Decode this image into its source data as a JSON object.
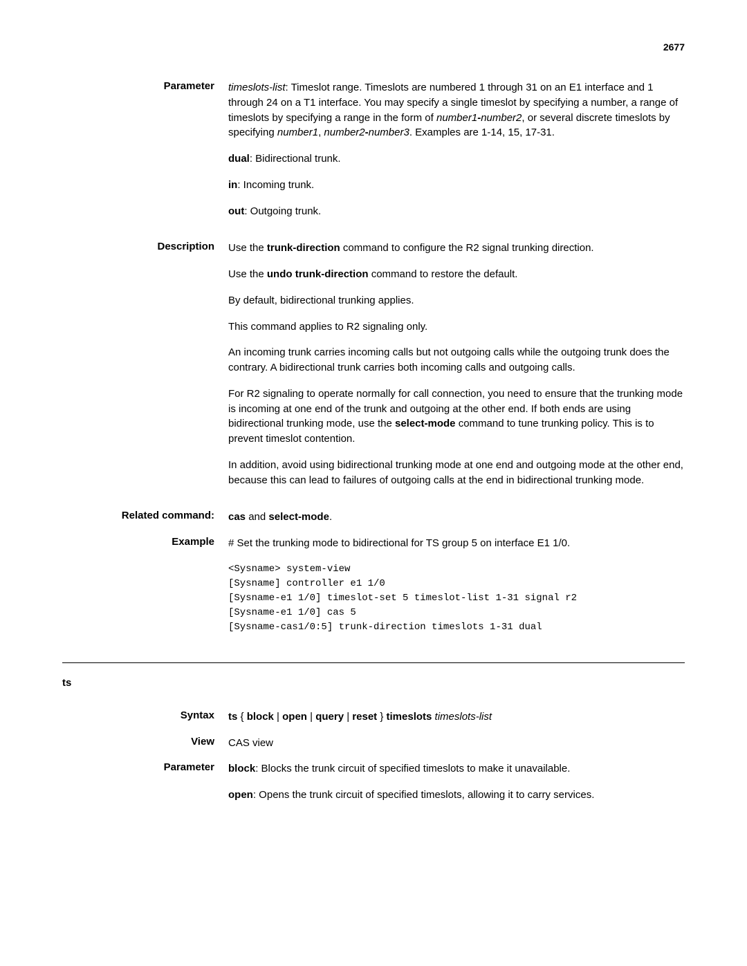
{
  "pageNumber": "2677",
  "sections1": {
    "parameter": {
      "label": "Parameter",
      "p1_a": "timeslots-list",
      "p1_b": ": Timeslot range. Timeslots are numbered 1 through 31 on an E1 interface and 1 through 24 on a T1 interface. You may specify a single timeslot by specifying a number, a range of timeslots by specifying a range in the form of ",
      "p1_c": "number1",
      "p1_d": "-",
      "p1_e": "number2",
      "p1_f": ", or several discrete timeslots by specifying ",
      "p1_g": "number1",
      "p1_h": ", ",
      "p1_i": "number2",
      "p1_j": "-",
      "p1_k": "number3",
      "p1_l": ". Examples are 1-14, 15, 17-31.",
      "p2_a": "dual",
      "p2_b": ": Bidirectional trunk.",
      "p3_a": "in",
      "p3_b": ": Incoming trunk.",
      "p4_a": "out",
      "p4_b": ": Outgoing trunk."
    },
    "description": {
      "label": "Description",
      "p1_a": "Use the ",
      "p1_b": "trunk-direction",
      "p1_c": " command to configure the R2 signal trunking direction.",
      "p2_a": "Use the ",
      "p2_b": "undo trunk-direction",
      "p2_c": " command to restore the default.",
      "p3": "By default, bidirectional trunking applies.",
      "p4": "This command applies to R2 signaling only.",
      "p5": "An incoming trunk carries incoming calls but not outgoing calls while the outgoing trunk does the contrary. A bidirectional trunk carries both incoming calls and outgoing calls.",
      "p6_a": "For R2 signaling to operate normally for call connection, you need to ensure that the trunking mode is incoming at one end of the trunk and outgoing at the other end. If both ends are using bidirectional trunking mode, use the ",
      "p6_b": "select-mode",
      "p6_c": " command to tune trunking policy. This is to prevent timeslot contention.",
      "p7": "In addition, avoid using bidirectional trunking mode at one end and outgoing mode at the other end, because this can lead to failures of outgoing calls at the end in bidirectional trunking mode."
    },
    "related": {
      "label": "Related command:",
      "a": "cas",
      "b": " and ",
      "c": "select-mode",
      "d": "."
    },
    "example": {
      "label": "Example",
      "p1": "# Set the trunking mode to bidirectional for TS group 5 on interface E1 1/0.",
      "code": "<Sysname> system-view\n[Sysname] controller e1 1/0\n[Sysname-e1 1/0] timeslot-set 5 timeslot-list 1-31 signal r2\n[Sysname-e1 1/0] cas 5\n[Sysname-cas1/0:5] trunk-direction timeslots 1-31 dual"
    }
  },
  "tsSection": {
    "title": "ts",
    "syntax": {
      "label": "Syntax",
      "a": "ts",
      "b": " { ",
      "c": "block",
      "d": " | ",
      "e": "open",
      "f": " | ",
      "g": "query",
      "h": " | ",
      "i": "reset",
      "j": " } ",
      "k": "timeslots",
      "l": " ",
      "m": "timeslots-list"
    },
    "view": {
      "label": "View",
      "text": "CAS view"
    },
    "parameter": {
      "label": "Parameter",
      "p1_a": "block",
      "p1_b": ": Blocks the trunk circuit of specified timeslots to make it unavailable.",
      "p2_a": "open",
      "p2_b": ": Opens the trunk circuit of specified timeslots, allowing it to carry services."
    }
  }
}
